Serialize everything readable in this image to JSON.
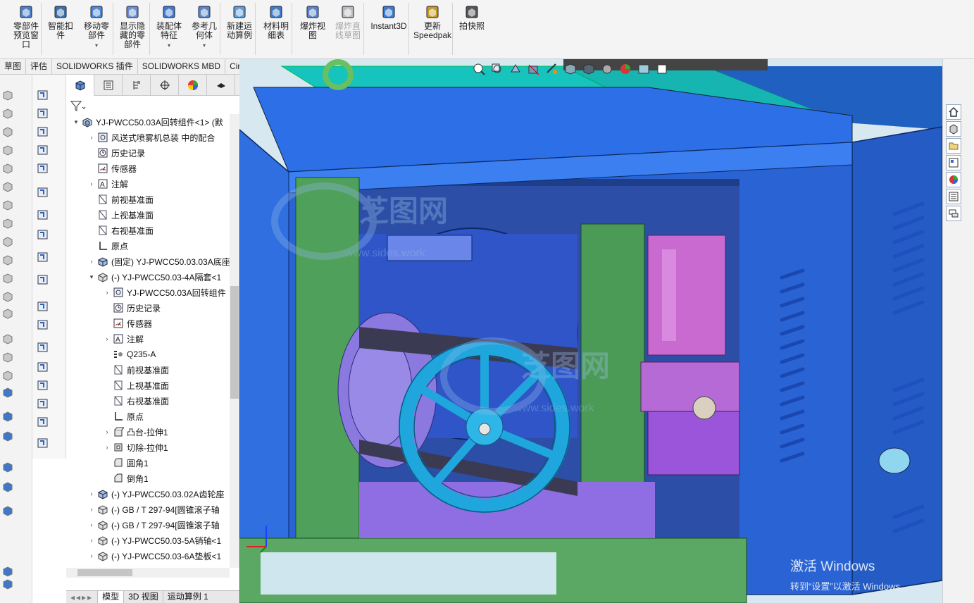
{
  "ribbon": {
    "buttons": [
      {
        "label": "零部件\n预览窗\n口",
        "icon": "preview-window-icon"
      },
      {
        "label": "智能扣\n件",
        "icon": "smart-fastener-icon"
      },
      {
        "label": "移动零\n部件",
        "icon": "move-component-icon"
      },
      {
        "label": "显示隐\n藏的零\n部件",
        "icon": "show-hidden-icon"
      },
      {
        "label": "装配体\n特征",
        "icon": "assembly-feature-icon"
      },
      {
        "label": "参考几\n何体",
        "icon": "reference-geometry-icon"
      },
      {
        "label": "新建运\n动算例",
        "icon": "motion-study-icon"
      },
      {
        "label": "材料明\n细表",
        "icon": "bom-icon"
      },
      {
        "label": "爆炸视\n图",
        "icon": "exploded-view-icon"
      },
      {
        "label": "爆炸直\n线草图",
        "icon": "explode-line-sketch-icon"
      },
      {
        "label": "Instant3D",
        "icon": "instant3d-icon"
      },
      {
        "label": "更新\nSpeedpak",
        "icon": "speedpak-icon"
      },
      {
        "label": "拍快照",
        "icon": "snapshot-icon"
      }
    ]
  },
  "tabs": [
    "草图",
    "评估",
    "SOLIDWORKS 插件",
    "SOLIDWORKS MBD",
    "CircuitWorks"
  ],
  "tree": [
    {
      "label": "YJ-PWCC50.03A回转组件<1> (默",
      "level": 0,
      "arrow": "down",
      "icon": "assembly"
    },
    {
      "label": "风送式喷雾机总装 中的配合",
      "level": 1,
      "arrow": "right",
      "icon": "mates"
    },
    {
      "label": "历史记录",
      "level": 1,
      "arrow": "",
      "icon": "history"
    },
    {
      "label": "传感器",
      "level": 1,
      "arrow": "",
      "icon": "sensor"
    },
    {
      "label": "注解",
      "level": 1,
      "arrow": "right",
      "icon": "annotation"
    },
    {
      "label": "前视基准面",
      "level": 1,
      "arrow": "",
      "icon": "plane"
    },
    {
      "label": "上视基准面",
      "level": 1,
      "arrow": "",
      "icon": "plane"
    },
    {
      "label": "右视基准面",
      "level": 1,
      "arrow": "",
      "icon": "plane"
    },
    {
      "label": "原点",
      "level": 1,
      "arrow": "",
      "icon": "origin"
    },
    {
      "label": "(固定) YJ-PWCC50.03.03A底座",
      "level": 1,
      "arrow": "right",
      "icon": "part"
    },
    {
      "label": "(-) YJ-PWCC50.03-4A隔套<1",
      "level": 1,
      "arrow": "down",
      "icon": "part-gray"
    },
    {
      "label": "YJ-PWCC50.03A回转组件",
      "level": 2,
      "arrow": "right",
      "icon": "mates"
    },
    {
      "label": "历史记录",
      "level": 2,
      "arrow": "",
      "icon": "history"
    },
    {
      "label": "传感器",
      "level": 2,
      "arrow": "",
      "icon": "sensor"
    },
    {
      "label": "注解",
      "level": 2,
      "arrow": "right",
      "icon": "annotation"
    },
    {
      "label": "Q235-A",
      "level": 2,
      "arrow": "",
      "icon": "material"
    },
    {
      "label": "前视基准面",
      "level": 2,
      "arrow": "",
      "icon": "plane"
    },
    {
      "label": "上视基准面",
      "level": 2,
      "arrow": "",
      "icon": "plane"
    },
    {
      "label": "右视基准面",
      "level": 2,
      "arrow": "",
      "icon": "plane"
    },
    {
      "label": "原点",
      "level": 2,
      "arrow": "",
      "icon": "origin"
    },
    {
      "label": "凸台-拉伸1",
      "level": 2,
      "arrow": "right",
      "icon": "extrude"
    },
    {
      "label": "切除-拉伸1",
      "level": 2,
      "arrow": "right",
      "icon": "cut"
    },
    {
      "label": "圆角1",
      "level": 2,
      "arrow": "",
      "icon": "fillet"
    },
    {
      "label": "倒角1",
      "level": 2,
      "arrow": "",
      "icon": "chamfer"
    },
    {
      "label": "(-) YJ-PWCC50.03.02A齿轮座",
      "level": 1,
      "arrow": "right",
      "icon": "part"
    },
    {
      "label": "(-) GB / T 297-94[圆锥滚子轴",
      "level": 1,
      "arrow": "right",
      "icon": "part-gray"
    },
    {
      "label": "(-) GB / T 297-94[圆锥滚子轴",
      "level": 1,
      "arrow": "right",
      "icon": "part-gray"
    },
    {
      "label": "(-) YJ-PWCC50.03-5A销轴<1",
      "level": 1,
      "arrow": "right",
      "icon": "part-gray"
    },
    {
      "label": "(-) YJ-PWCC50.03-6A垫板<1",
      "level": 1,
      "arrow": "right",
      "icon": "part-gray"
    }
  ],
  "bottom_tabs": [
    "模型",
    "3D 视图",
    "运动算例 1"
  ],
  "watermark": {
    "title": "激活 Windows",
    "subtitle": "转到“设置”以激活 Windows。"
  },
  "logo_watermark": {
    "text1": "芝图网",
    "text2": "www.sides.work"
  },
  "colors": {
    "accent": "#1f6fd1",
    "frame_blue": "#2f6fe0",
    "post_green": "#4e9b58",
    "top_cyan": "#18c6c0",
    "pulley": "#1fa6dc",
    "pump_purple": "#a05ad6"
  }
}
